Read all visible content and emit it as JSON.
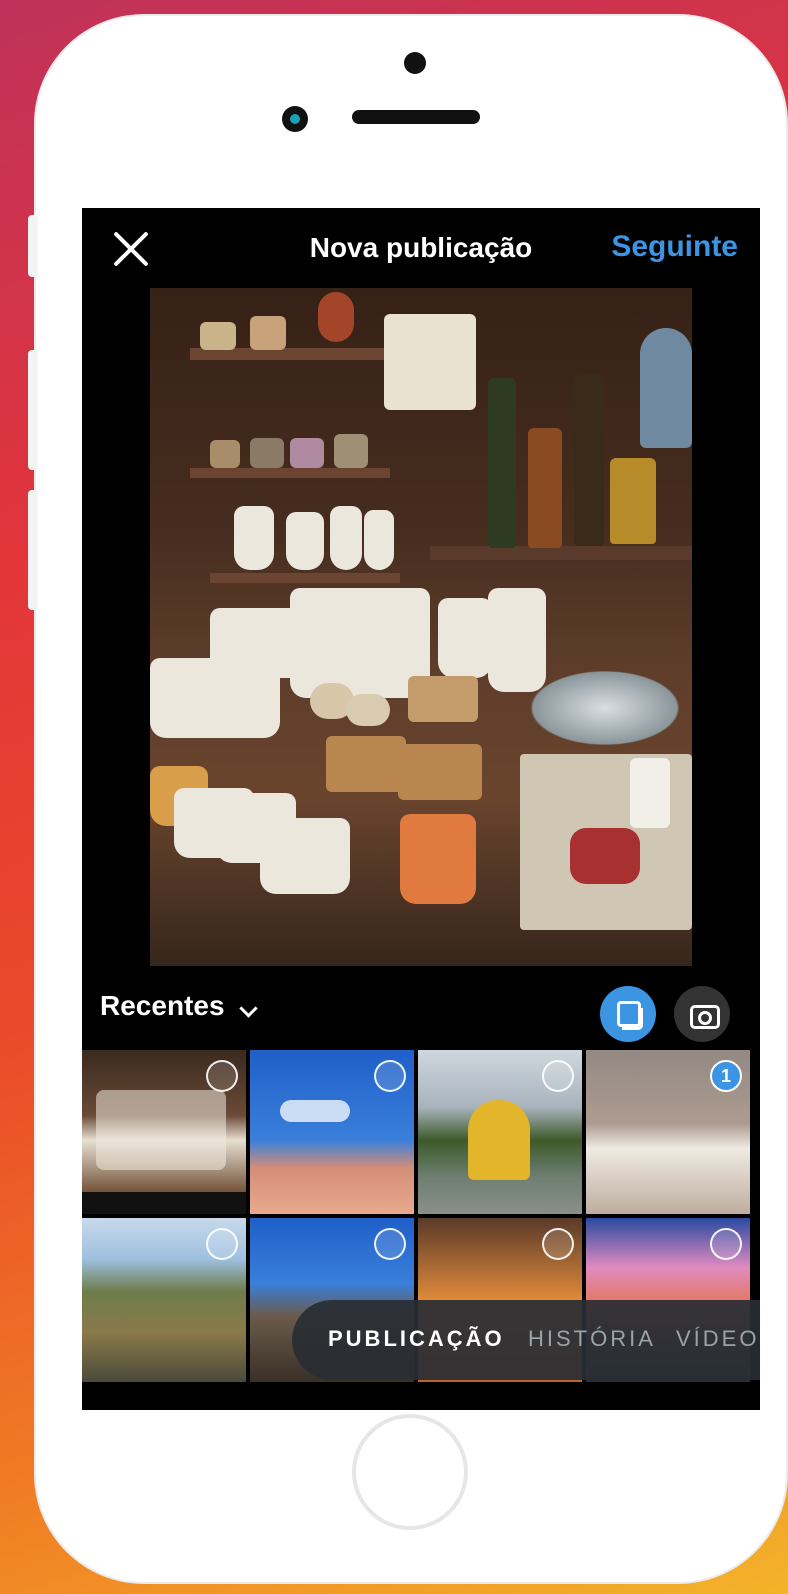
{
  "header": {
    "close_icon": "close-icon",
    "title": "Nova publicação",
    "next_label": "Seguinte"
  },
  "gallery": {
    "album_label": "Recentes",
    "album_chevron_icon": "chevron-down-icon",
    "multi_select_icon": "multi-select-icon",
    "camera_icon": "camera-icon",
    "selected_number": "1"
  },
  "modes": {
    "items": [
      "PUBLICAÇÃO",
      "HISTÓRIA",
      "VÍDEO"
    ],
    "active": "PUBLICAÇÃO"
  },
  "colors": {
    "accent": "#3b95e3",
    "background": "#000000"
  }
}
